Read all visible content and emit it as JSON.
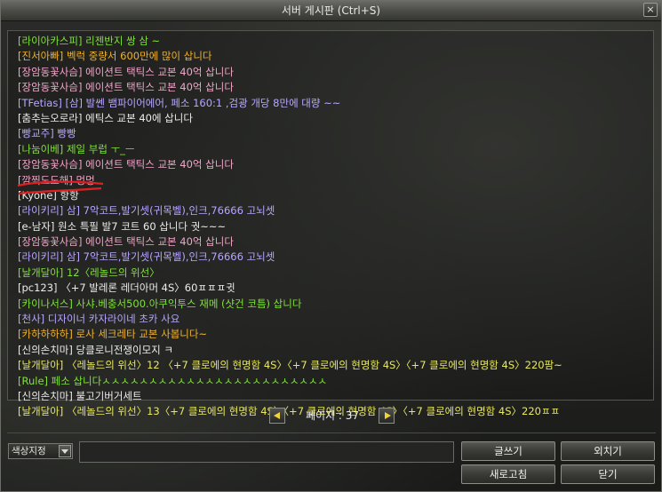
{
  "window": {
    "title": "서버 게시판 (Ctrl+S)",
    "close_icon": "×"
  },
  "messages": [
    {
      "text": "[라이아카스피] 리젠반지 쌍 삼 ~",
      "color": "green"
    },
    {
      "text": "[진서아빠] 벡럭 중량서 600만에 많이 삽니다",
      "color": "orange"
    },
    {
      "text": "[장암동꽃사슴] 에이션트 택틱스 교본 40억 삽니다",
      "color": "pink"
    },
    {
      "text": "[장암동꽃사슴] 에이션트 택틱스 교본 40억 삽니다",
      "color": "pink"
    },
    {
      "text": "[TFetias] [삼] 발쎈 뱀파이어에어, 페소 160:1 ,검광 개당 8만에 대량 ~~",
      "color": "violet"
    },
    {
      "text": "[춤추는오로라] 에틱스 교본 40에 삽니다",
      "color": "white"
    },
    {
      "text": "[빵교주] 빵빵",
      "color": "violet"
    },
    {
      "text": "[나눔이베] 제일 부럽 ㅜ_ㅡ",
      "color": "green"
    },
    {
      "text": "[장암동꽃사슴] 에이션트 택틱스 교본 40억 삽니다",
      "color": "pink"
    },
    {
      "text": "[깜찍도도해] 멍멍",
      "color": "pink"
    },
    {
      "text": "[Kyone] 항항",
      "color": "white"
    },
    {
      "text": "[라이키리] 삼] 7악코트,발기셋(귀목벨),인크,76666 고뇌셋",
      "color": "violet"
    },
    {
      "text": "[e-남자] 원소 특필 발7 코트 60 삽니다 궛~~~",
      "color": "white"
    },
    {
      "text": "[장암동꽃사슴] 에이션트 택틱스 교본 40억 삽니다",
      "color": "pink"
    },
    {
      "text": "[라이키리] 삼] 7악코트,발기셋(귀목벨),인크,76666 고뇌셋",
      "color": "violet"
    },
    {
      "text": "[날개달아] 12〈레놀드의 위선〉",
      "color": "green"
    },
    {
      "text": "[pc123] 〈+7 발레론 레더아머 4S〉60ㅍㅍㅍ귓",
      "color": "white"
    },
    {
      "text": "[카이나서스] 사샤.베충서500.아쿠익투스 재메 (샷건 코틈) 삽니다",
      "color": "green"
    },
    {
      "text": "[천사] 디자이너 카자라이네 초카 사요",
      "color": "violet"
    },
    {
      "text": "[카하하하하] 로사 세크레타 교본 사봅니다~",
      "color": "orange"
    },
    {
      "text": "[신의손치마] 당클로니전쟁이모지 ㅋ",
      "color": "white"
    },
    {
      "text": "[날개달아] 〈레놀드의 위선〉12 〈+7 클로에의 현명함 4S〉〈+7 클로에의 현명함 4S〉〈+7 클로에의 현명함 4S〉220팜~",
      "color": "yellow"
    },
    {
      "text": "[Rule] 페소 삽니다ㅅㅅㅅㅅㅅㅅㅅㅅㅅㅅㅅㅅㅅㅅㅅㅅㅅㅅㅅㅅㅅㅅㅅㅅ",
      "color": "green"
    },
    {
      "text": "[신의손치마] 불고기버거세트",
      "color": "white"
    },
    {
      "text": "[날개달아] 〈레놀드의 위선〉13〈+7 클로에의 현명함 4S〉〈+7 클로에의 현명함 4S〉〈+7 클로에의 현명함 4S〉220ㅍㅍ",
      "color": "yellow"
    }
  ],
  "colors": {
    "green": "#7fe238",
    "orange": "#f0b22c",
    "white": "#ececec",
    "yellow": "#e8e85a",
    "violet": "#b8a6ff",
    "pink": "#f0a6c8",
    "annotation": "#e02020"
  },
  "pagination": {
    "label": "페이지 : 37",
    "prev_icon": "triangle-left",
    "next_icon": "triangle-right"
  },
  "input_bar": {
    "color_select_label": "색상지정",
    "dropdown_icon": "triangle-down",
    "input_value": ""
  },
  "buttons": {
    "write": "글쓰기",
    "whisper": "외치기",
    "refresh": "새로고침",
    "close": "닫기"
  }
}
